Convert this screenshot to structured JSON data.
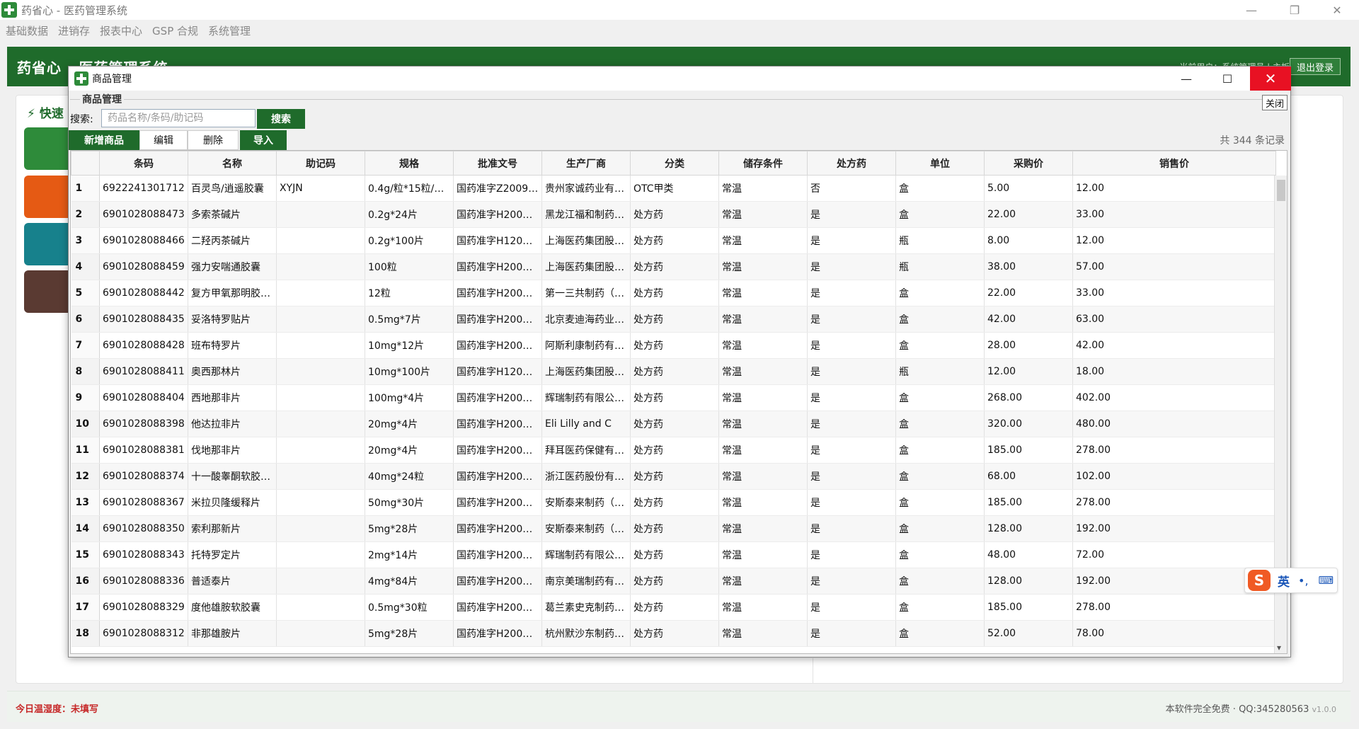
{
  "app": {
    "title": "药省心 - 医药管理系统"
  },
  "menu": [
    "基础数据",
    "进销存",
    "报表中心",
    "GSP 合规",
    "系统管理"
  ],
  "header": {
    "title": "药省心 · 医药管理系统",
    "right_text": "当前用户：系统管理员 | 主板",
    "logout": "退出登录"
  },
  "quick": {
    "label": "快速"
  },
  "dialog": {
    "title": "商品管理",
    "group": "商品管理",
    "close_small": "关闭",
    "search_label": "搜索:",
    "search_placeholder": "药品名称/条码/助记码",
    "search_button": "搜索",
    "toolbar": {
      "add": "新增商品",
      "edit": "编辑",
      "delete": "删除",
      "import": "导入"
    },
    "record_count": "共 344 条记录"
  },
  "table": {
    "columns": [
      "",
      "条码",
      "名称",
      "助记码",
      "规格",
      "批准文号",
      "生产厂商",
      "分类",
      "储存条件",
      "处方药",
      "单位",
      "采购价",
      "销售价"
    ],
    "rows": [
      [
        "1",
        "6922241301712",
        "百灵鸟/逍遥胶囊",
        "XYJN",
        "0.4g/粒*15粒/…",
        "国药准字Z2009…",
        "贵州家诚药业有…",
        "OTC甲类",
        "常温",
        "否",
        "盒",
        "5.00",
        "12.00"
      ],
      [
        "2",
        "6901028088473",
        "多索茶碱片",
        "",
        "0.2g*24片",
        "国药准字H200…",
        "黑龙江福和制药…",
        "处方药",
        "常温",
        "是",
        "盒",
        "22.00",
        "33.00"
      ],
      [
        "3",
        "6901028088466",
        "二羟丙茶碱片",
        "",
        "0.2g*100片",
        "国药准字H120…",
        "上海医药集团股…",
        "处方药",
        "常温",
        "是",
        "瓶",
        "8.00",
        "12.00"
      ],
      [
        "4",
        "6901028088459",
        "强力安喘通胶囊",
        "",
        "100粒",
        "国药准字H200…",
        "上海医药集团股…",
        "处方药",
        "常温",
        "是",
        "瓶",
        "38.00",
        "57.00"
      ],
      [
        "5",
        "6901028088442",
        "复方甲氧那明胶…",
        "",
        "12粒",
        "国药准字H200…",
        "第一三共制药（…",
        "处方药",
        "常温",
        "是",
        "盒",
        "22.00",
        "33.00"
      ],
      [
        "6",
        "6901028088435",
        "妥洛特罗贴片",
        "",
        "0.5mg*7片",
        "国药准字H200…",
        "北京麦迪海药业…",
        "处方药",
        "常温",
        "是",
        "盒",
        "42.00",
        "63.00"
      ],
      [
        "7",
        "6901028088428",
        "班布特罗片",
        "",
        "10mg*12片",
        "国药准字H200…",
        "阿斯利康制药有…",
        "处方药",
        "常温",
        "是",
        "盒",
        "28.00",
        "42.00"
      ],
      [
        "8",
        "6901028088411",
        "奥西那林片",
        "",
        "10mg*100片",
        "国药准字H120…",
        "上海医药集团股…",
        "处方药",
        "常温",
        "是",
        "瓶",
        "12.00",
        "18.00"
      ],
      [
        "9",
        "6901028088404",
        "西地那非片",
        "",
        "100mg*4片",
        "国药准字H200…",
        "辉瑞制药有限公…",
        "处方药",
        "常温",
        "是",
        "盒",
        "268.00",
        "402.00"
      ],
      [
        "10",
        "6901028088398",
        "他达拉非片",
        "",
        "20mg*4片",
        "国药准字H200…",
        "Eli Lilly and C",
        "处方药",
        "常温",
        "是",
        "盒",
        "320.00",
        "480.00"
      ],
      [
        "11",
        "6901028088381",
        "伐地那非片",
        "",
        "20mg*4片",
        "国药准字H200…",
        "拜耳医药保健有…",
        "处方药",
        "常温",
        "是",
        "盒",
        "185.00",
        "278.00"
      ],
      [
        "12",
        "6901028088374",
        "十一酸睾酮软胶…",
        "",
        "40mg*24粒",
        "国药准字H200…",
        "浙江医药股份有…",
        "处方药",
        "常温",
        "是",
        "盒",
        "68.00",
        "102.00"
      ],
      [
        "13",
        "6901028088367",
        "米拉贝隆缓释片",
        "",
        "50mg*30片",
        "国药准字H200…",
        "安斯泰来制药（…",
        "处方药",
        "常温",
        "是",
        "盒",
        "185.00",
        "278.00"
      ],
      [
        "14",
        "6901028088350",
        "索利那新片",
        "",
        "5mg*28片",
        "国药准字H200…",
        "安斯泰来制药（…",
        "处方药",
        "常温",
        "是",
        "盒",
        "128.00",
        "192.00"
      ],
      [
        "15",
        "6901028088343",
        "托特罗定片",
        "",
        "2mg*14片",
        "国药准字H200…",
        "辉瑞制药有限公…",
        "处方药",
        "常温",
        "是",
        "盒",
        "48.00",
        "72.00"
      ],
      [
        "16",
        "6901028088336",
        "普适泰片",
        "",
        "4mg*84片",
        "国药准字H200…",
        "南京美瑞制药有…",
        "处方药",
        "常温",
        "是",
        "盒",
        "128.00",
        "192.00"
      ],
      [
        "17",
        "6901028088329",
        "度他雄胺软胶囊",
        "",
        "0.5mg*30粒",
        "国药准字H200…",
        "葛兰素史克制药…",
        "处方药",
        "常温",
        "是",
        "盒",
        "185.00",
        "278.00"
      ],
      [
        "18",
        "6901028088312",
        "非那雄胺片",
        "",
        "5mg*28片",
        "国药准字H200…",
        "杭州默沙东制药…",
        "处方药",
        "常温",
        "是",
        "盒",
        "52.00",
        "78.00"
      ]
    ]
  },
  "footer": {
    "left": "今日温湿度：未填写",
    "right": "本软件完全免费 · QQ:345280563",
    "version": "v1.0.0"
  },
  "ime": {
    "logo": "S",
    "lang": "英",
    "punct": "•,",
    "keyboard": "⌨"
  }
}
